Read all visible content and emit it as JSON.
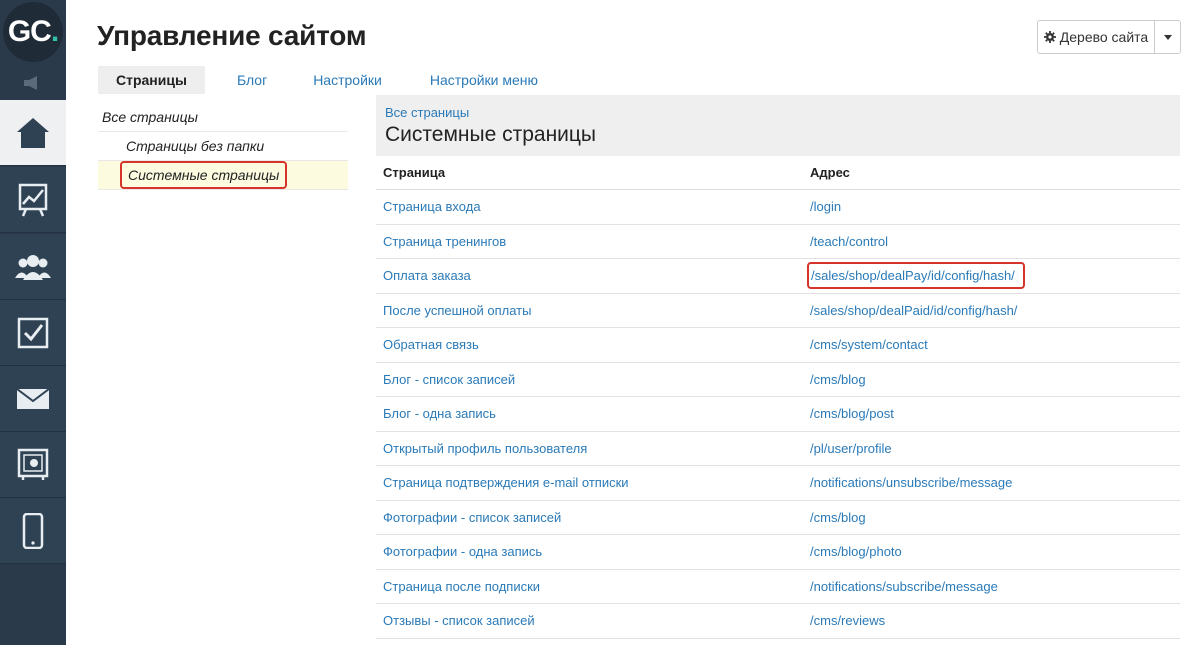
{
  "app": {
    "logo_text": "GC",
    "title": "Управление сайтом",
    "tree_button_label": "Дерево сайта"
  },
  "sidebar": {
    "items": [
      {
        "icon": "home-icon",
        "active": true
      },
      {
        "icon": "chart-icon",
        "active": false
      },
      {
        "icon": "users-icon",
        "active": false
      },
      {
        "icon": "checkbox-icon",
        "active": false
      },
      {
        "icon": "mail-icon",
        "active": false
      },
      {
        "icon": "safe-icon",
        "active": false
      },
      {
        "icon": "phone-icon",
        "active": false
      }
    ]
  },
  "tabs": [
    {
      "label": "Страницы",
      "active": true
    },
    {
      "label": "Блог",
      "active": false
    },
    {
      "label": "Настройки",
      "active": false
    },
    {
      "label": "Настройки меню",
      "active": false
    }
  ],
  "tree": {
    "root": "Все страницы",
    "children": [
      "Страницы без папки",
      "Системные страницы"
    ],
    "selected": "Системные страницы"
  },
  "panel": {
    "breadcrumb": "Все страницы",
    "title": "Системные страницы"
  },
  "table": {
    "columns": [
      "Страница",
      "Адрес"
    ],
    "rows": [
      {
        "page": "Страница входа",
        "address": "/login"
      },
      {
        "page": "Страница тренингов",
        "address": "/teach/control"
      },
      {
        "page": "Оплата заказа",
        "address": "/sales/shop/dealPay/id/config/hash/"
      },
      {
        "page": "После успешной оплаты",
        "address": "/sales/shop/dealPaid/id/config/hash/"
      },
      {
        "page": "Обратная связь",
        "address": "/cms/system/contact"
      },
      {
        "page": "Блог - список записей",
        "address": "/cms/blog"
      },
      {
        "page": "Блог - одна запись",
        "address": "/cms/blog/post"
      },
      {
        "page": "Открытый профиль пользователя",
        "address": "/pl/user/profile"
      },
      {
        "page": "Страница подтверждения e-mail отписки",
        "address": "/notifications/unsubscribe/message"
      },
      {
        "page": "Фотографии - список записей",
        "address": "/cms/blog"
      },
      {
        "page": "Фотографии - одна запись",
        "address": "/cms/blog/photo"
      },
      {
        "page": "Страница после подписки",
        "address": "/notifications/subscribe/message"
      },
      {
        "page": "Отзывы - список записей",
        "address": "/cms/reviews"
      }
    ]
  },
  "colors": {
    "sidebar_bg": "#2b3a4a",
    "link": "#2a7ab8",
    "highlight": "#d6332b",
    "selected_bg": "#fcfbe0"
  }
}
